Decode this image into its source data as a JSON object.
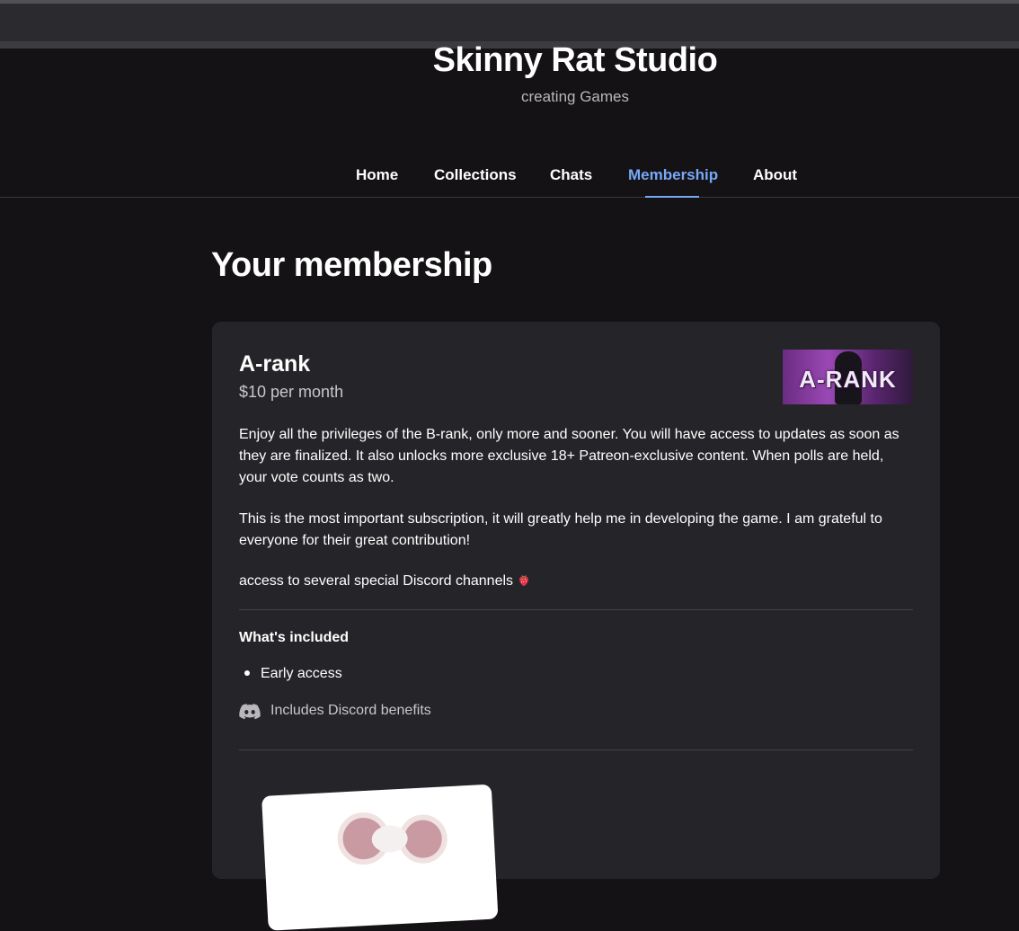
{
  "header": {
    "studio_name": "Skinny Rat Studio",
    "tagline": "creating Games"
  },
  "nav": {
    "items": [
      {
        "label": "Home",
        "active": false
      },
      {
        "label": "Collections",
        "active": false
      },
      {
        "label": "Chats",
        "active": false
      },
      {
        "label": "Membership",
        "active": true
      },
      {
        "label": "About",
        "active": false
      }
    ]
  },
  "page": {
    "title": "Your membership"
  },
  "tier": {
    "name": "A-rank",
    "price": "$10 per month",
    "banner_text": "A-RANK",
    "description": [
      "Enjoy all the privileges of the B-rank, only more and sooner. You will have access to updates as soon as they are finalized. It also unlocks more exclusive 18+ Patreon-exclusive content. When polls are held, your vote counts as two.",
      "This is the most important subscription, it will greatly help me in developing the game. I am grateful to everyone for their great contribution!",
      "access to several special Discord channels"
    ],
    "included_heading": "What's included",
    "benefits": [
      "Early access"
    ],
    "discord_benefit": "Includes Discord benefits"
  },
  "colors": {
    "accent": "#78a8f8",
    "background": "#141214",
    "card": "#252428"
  }
}
